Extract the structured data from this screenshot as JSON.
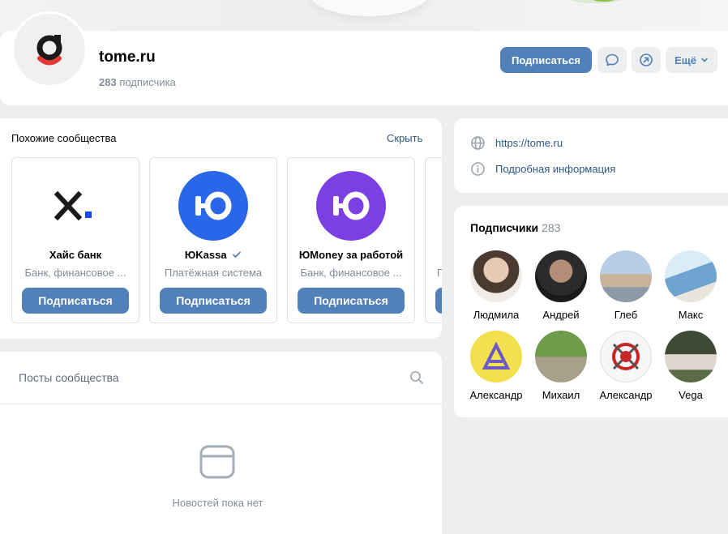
{
  "community": {
    "name": "tome.ru",
    "subscribers_count": "283",
    "subscribers_label": "подписчика",
    "subscribe_label": "Подписаться",
    "more_label": "Ещё"
  },
  "similar": {
    "title": "Похожие сообщества",
    "hide_label": "Скрыть",
    "items": [
      {
        "name": "Хайс банк",
        "desc": "Банк, финансовое ...",
        "button": "Подписаться",
        "logo": "x-dot-logo"
      },
      {
        "name": "ЮKassa",
        "desc": "Платёжная система",
        "button": "Подписаться",
        "logo": "yukassa-logo",
        "verified": true
      },
      {
        "name": "ЮMoney за работой",
        "desc": "Банк, финансовое ...",
        "button": "Подписаться",
        "logo": "yumoney-logo"
      },
      {
        "name": "",
        "desc": "П",
        "button": "Подписаться",
        "logo": "partial"
      }
    ]
  },
  "posts": {
    "title": "Посты сообщества",
    "empty_text": "Новостей пока нет"
  },
  "links": {
    "website": "https://tome.ru",
    "details": "Подробная информация"
  },
  "subscribers": {
    "title": "Подписчики",
    "count": "283",
    "members": [
      {
        "name": "Людмила",
        "color": "#6b5a4e"
      },
      {
        "name": "Андрей",
        "color": "#3a3a3a"
      },
      {
        "name": "Глеб",
        "color": "#8aa9c8"
      },
      {
        "name": "Макс",
        "color": "#9cc3e0"
      },
      {
        "name": "Александр",
        "color": "#f2e14d"
      },
      {
        "name": "Михаил",
        "color": "#7a8f5c"
      },
      {
        "name": "Александр",
        "color": "#f4f4f4"
      },
      {
        "name": "Vega",
        "color": "#4a5a3c"
      }
    ]
  },
  "colors": {
    "accent": "#5181b8",
    "link": "#2a5885",
    "muted": "#818c99"
  }
}
